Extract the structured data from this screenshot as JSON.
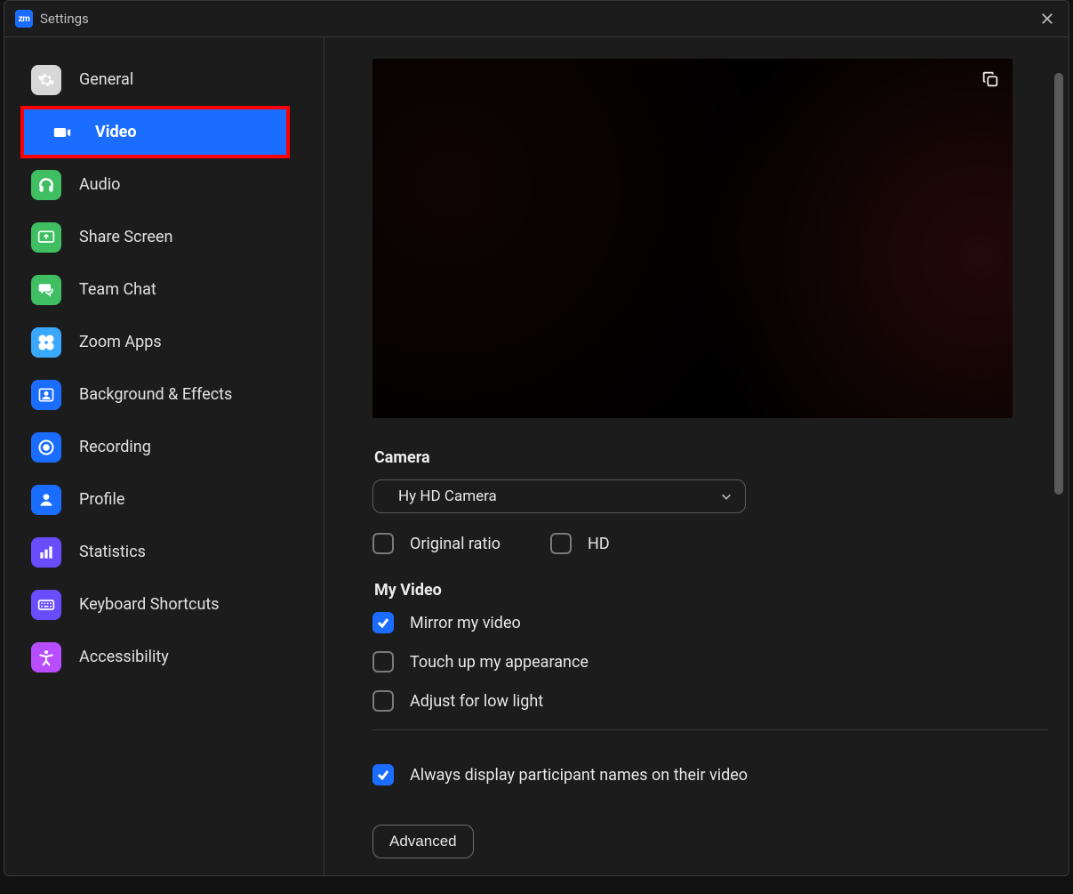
{
  "icons": {
    "app_badge": "zm"
  },
  "titlebar": {
    "title": "Settings"
  },
  "sidebar": {
    "items": [
      {
        "label": "General",
        "icon_name": "gear-icon",
        "color": "#d7d7d7"
      },
      {
        "label": "Video",
        "icon_name": "video-icon",
        "color": "#ffffff",
        "active": true,
        "highlighted": true
      },
      {
        "label": "Audio",
        "icon_name": "headphones-icon",
        "color": "#3fbf62"
      },
      {
        "label": "Share Screen",
        "icon_name": "share-screen-icon",
        "color": "#3fbf62"
      },
      {
        "label": "Team Chat",
        "icon_name": "chat-icon",
        "color": "#3fbf62"
      },
      {
        "label": "Zoom Apps",
        "icon_name": "apps-icon",
        "color": "#3aa8ff"
      },
      {
        "label": "Background & Effects",
        "icon_name": "background-icon",
        "color": "#1a6dff"
      },
      {
        "label": "Recording",
        "icon_name": "record-icon",
        "color": "#1a6dff"
      },
      {
        "label": "Profile",
        "icon_name": "profile-icon",
        "color": "#1a6dff"
      },
      {
        "label": "Statistics",
        "icon_name": "statistics-icon",
        "color": "#6a4cff"
      },
      {
        "label": "Keyboard Shortcuts",
        "icon_name": "keyboard-icon",
        "color": "#6a4cff"
      },
      {
        "label": "Accessibility",
        "icon_name": "accessibility-icon",
        "color": "#b84cff"
      }
    ]
  },
  "video": {
    "camera_label": "Camera",
    "camera_selected": "Hy HD Camera",
    "original_ratio_label": "Original ratio",
    "original_ratio_checked": false,
    "hd_label": "HD",
    "hd_checked": false,
    "my_video_label": "My Video",
    "mirror_label": "Mirror my video",
    "mirror_checked": true,
    "touchup_label": "Touch up my appearance",
    "touchup_checked": false,
    "lowlight_label": "Adjust for low light",
    "lowlight_checked": false,
    "always_names_label": "Always display participant names on their video",
    "always_names_checked": true,
    "advanced_label": "Advanced"
  }
}
